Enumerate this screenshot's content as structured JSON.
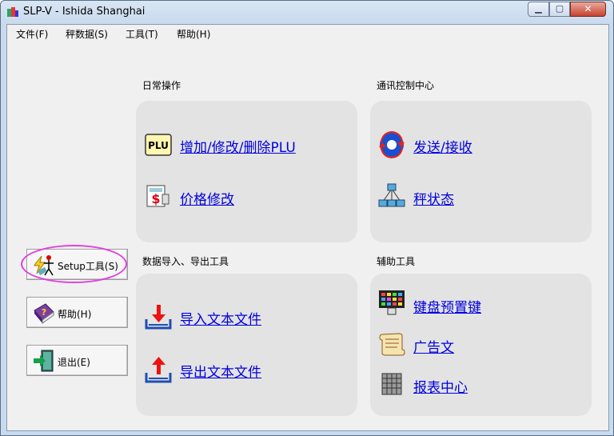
{
  "window": {
    "title": "SLP-V - Ishida Shanghai"
  },
  "menu": [
    {
      "label": "文件(F)"
    },
    {
      "label": "秤数据(S)"
    },
    {
      "label": "工具(T)"
    },
    {
      "label": "帮助(H)"
    }
  ],
  "sections": {
    "daily": {
      "title": "日常操作",
      "links": [
        "增加/修改/删除PLU",
        "价格修改"
      ]
    },
    "comm": {
      "title": "通讯控制中心",
      "links": [
        "发送/接收",
        "秤状态"
      ]
    },
    "data": {
      "title": "数据导入、导出工具",
      "links": [
        "导入文本文件",
        "导出文本文件"
      ]
    },
    "aux": {
      "title": "辅助工具",
      "links": [
        "键盘预置键",
        "广告文",
        "报表中心"
      ]
    }
  },
  "side_buttons": [
    {
      "label": "Setup工具(S)"
    },
    {
      "label": "帮助(H)"
    },
    {
      "label": "退出(E)"
    }
  ],
  "icons": {
    "plu_text": "PLU"
  },
  "colors": {
    "link": "#0000e0",
    "panel": "#e3e3e3",
    "highlight": "#e040e0"
  }
}
